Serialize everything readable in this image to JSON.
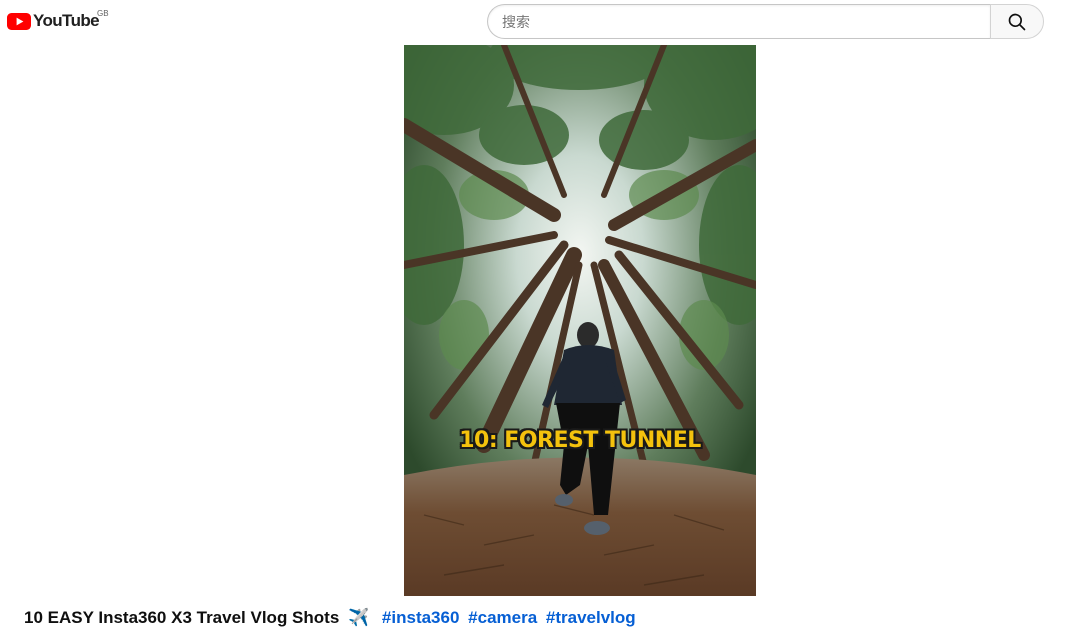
{
  "header": {
    "logo_text": "YouTube",
    "country_code": "GB",
    "search_placeholder": "搜索",
    "search_icon": "search-icon",
    "brand_red": "#ff0000"
  },
  "video": {
    "caption": "10: FOREST TUNNEL",
    "caption_color": "#f4c20d"
  },
  "title": {
    "text": "10 EASY Insta360 X3 Travel Vlog Shots",
    "emoji": "✈️",
    "hashtags": [
      "#insta360",
      "#camera",
      "#travelvlog"
    ],
    "link_color": "#065fd4"
  }
}
